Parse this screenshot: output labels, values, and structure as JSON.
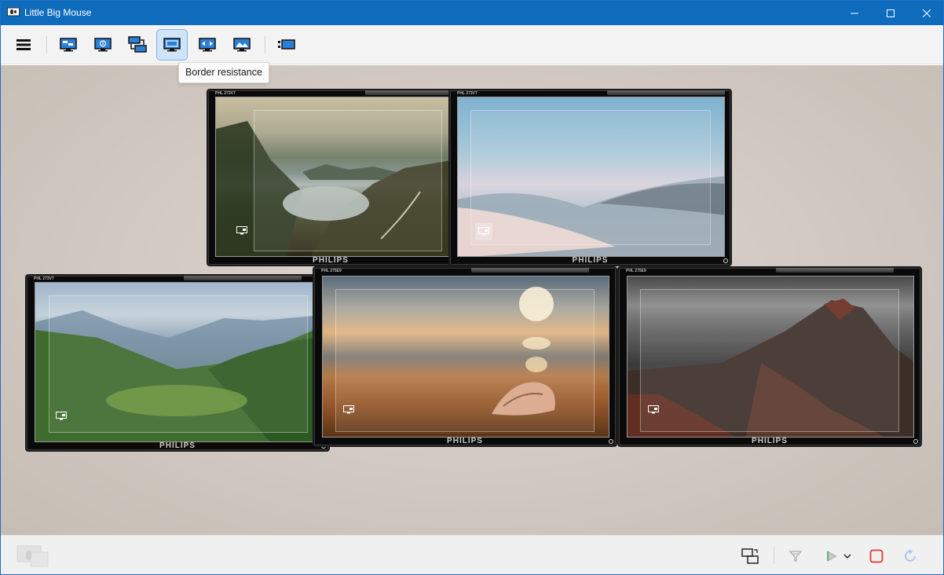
{
  "window": {
    "title": "Little Big Mouse",
    "accent": "#0f6cbd"
  },
  "toolbar": {
    "buttons": [
      {
        "icon": "hamburger-menu-icon"
      },
      {
        "icon": "monitor-layout-icon"
      },
      {
        "icon": "monitor-info-icon"
      },
      {
        "icon": "monitor-stack-icon"
      },
      {
        "icon": "monitor-border-icon",
        "active": true
      },
      {
        "icon": "monitor-arrows-icon"
      },
      {
        "icon": "monitor-wallpaper-icon"
      },
      {
        "icon": "monitor-list-icon"
      }
    ],
    "tooltip": "Border resistance"
  },
  "monitors": [
    {
      "model": "PHL 273V7",
      "brand": "PHILIPS",
      "wallpaper": "fjord-landscape"
    },
    {
      "model": "PHL 273V7",
      "brand": "PHILIPS",
      "wallpaper": "snow-dunes"
    },
    {
      "model": "PHL 273V7",
      "brand": "PHILIPS",
      "wallpaper": "mountain-valley"
    },
    {
      "model": "PHL 275E9",
      "brand": "PHILIPS",
      "wallpaper": "seashell-sunset"
    },
    {
      "model": "PHL 275E9",
      "brand": "PHILIPS",
      "wallpaper": "volcano"
    }
  ],
  "statusbar": {
    "icons": [
      "app-logo-icon",
      "monitor-swap-icon",
      "filter-icon",
      "play-icon",
      "dropdown-chevron-icon",
      "stop-icon",
      "undo-icon"
    ]
  }
}
